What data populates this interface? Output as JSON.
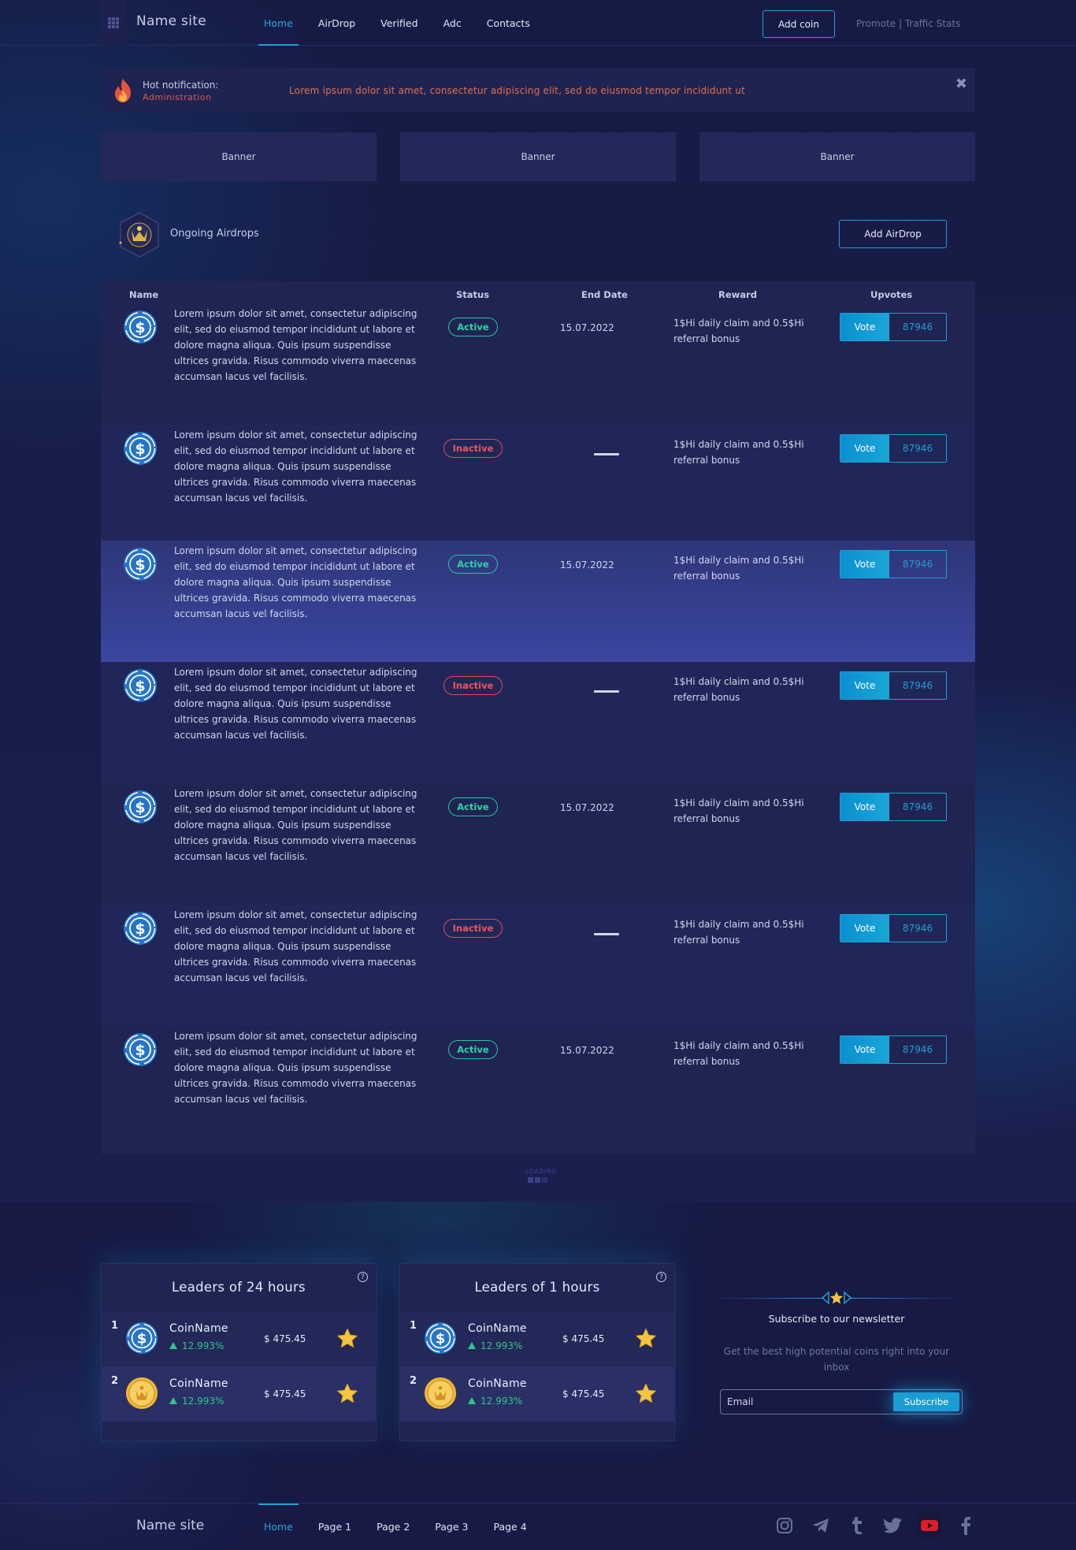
{
  "header": {
    "site_name": "Name site",
    "nav": [
      "Home",
      "AirDrop",
      "Verified",
      "Adc",
      "Contacts"
    ],
    "add_coin": "Add coin",
    "links": "Promote | Traffic Stats"
  },
  "notification": {
    "title": "Hot notification:",
    "subtitle": "Administration",
    "text": "Lorem ipsum dolor sit amet, consectetur adipiscing elit, sed do eiusmod tempor incididunt ut",
    "close": "✖"
  },
  "banners": [
    "Banner",
    "Banner",
    "Banner"
  ],
  "section": {
    "title": "Ongoing Airdrops",
    "add_button": "Add AirDrop"
  },
  "table": {
    "headers": [
      "Name",
      "Status",
      "End Date",
      "Reward",
      "Upvotes"
    ],
    "rows": [
      {
        "desc": "Lorem ipsum dolor sit amet, consectetur adipiscing elit, sed do eiusmod tempor incididunt ut labore et dolore magna aliqua. Quis ipsum suspendisse ultrices gravida. Risus commodo viverra maecenas accumsan lacus vel facilisis.",
        "status": "Active",
        "end_date": "15.07.2022",
        "reward": "1$Hi daily claim and 0.5$Hi referral bonus",
        "vote": "Vote",
        "count": "87946"
      },
      {
        "desc": "Lorem ipsum dolor sit amet, consectetur adipiscing elit, sed do eiusmod tempor incididunt ut labore et dolore magna aliqua. Quis ipsum suspendisse ultrices gravida. Risus commodo viverra maecenas accumsan lacus vel facilisis.",
        "status": "Inactive",
        "end_date": "",
        "reward": "1$Hi daily claim and 0.5$Hi referral bonus",
        "vote": "Vote",
        "count": "87946"
      },
      {
        "desc": "Lorem ipsum dolor sit amet, consectetur adipiscing elit, sed do eiusmod tempor incididunt ut labore et dolore magna aliqua. Quis ipsum suspendisse ultrices gravida. Risus commodo viverra maecenas accumsan lacus vel facilisis.",
        "status": "Active",
        "end_date": "15.07.2022",
        "reward": "1$Hi daily claim and 0.5$Hi referral bonus",
        "vote": "Vote",
        "count": "87946"
      },
      {
        "desc": "Lorem ipsum dolor sit amet, consectetur adipiscing elit, sed do eiusmod tempor incididunt ut labore et dolore magna aliqua. Quis ipsum suspendisse ultrices gravida. Risus commodo viverra maecenas accumsan lacus vel facilisis.",
        "status": "Inactive",
        "end_date": "",
        "reward": "1$Hi daily claim and 0.5$Hi referral bonus",
        "vote": "Vote",
        "count": "87946"
      },
      {
        "desc": "Lorem ipsum dolor sit amet, consectetur adipiscing elit, sed do eiusmod tempor incididunt ut labore et dolore magna aliqua. Quis ipsum suspendisse ultrices gravida. Risus commodo viverra maecenas accumsan lacus vel facilisis.",
        "status": "Active",
        "end_date": "15.07.2022",
        "reward": "1$Hi daily claim and 0.5$Hi referral bonus",
        "vote": "Vote",
        "count": "87946"
      },
      {
        "desc": "Lorem ipsum dolor sit amet, consectetur adipiscing elit, sed do eiusmod tempor incididunt ut labore et dolore magna aliqua. Quis ipsum suspendisse ultrices gravida. Risus commodo viverra maecenas accumsan lacus vel facilisis.",
        "status": "Inactive",
        "end_date": "",
        "reward": "1$Hi daily claim and 0.5$Hi referral bonus",
        "vote": "Vote",
        "count": "87946"
      },
      {
        "desc": "Lorem ipsum dolor sit amet, consectetur adipiscing elit, sed do eiusmod tempor incididunt ut labore et dolore magna aliqua. Quis ipsum suspendisse ultrices gravida. Risus commodo viverra maecenas accumsan lacus vel facilisis.",
        "status": "Active",
        "end_date": "15.07.2022",
        "reward": "1$Hi daily claim and 0.5$Hi referral bonus",
        "vote": "Vote",
        "count": "87946"
      }
    ]
  },
  "loading": "LOADING",
  "leaders": [
    {
      "title": "Leaders of 24 hours",
      "rows": [
        {
          "rank": "1",
          "name": "CoinName",
          "change": "12.993%",
          "price": "$ 475.45",
          "coin": "usdc-icon"
        },
        {
          "rank": "2",
          "name": "CoinName",
          "change": "12.993%",
          "price": "$ 475.45",
          "coin": "gold-coin-icon"
        }
      ]
    },
    {
      "title": "Leaders of 1 hours",
      "rows": [
        {
          "rank": "1",
          "name": "CoinName",
          "change": "12.993%",
          "price": "$ 475.45",
          "coin": "usdc-icon"
        },
        {
          "rank": "2",
          "name": "CoinName",
          "change": "12.993%",
          "price": "$ 475.45",
          "coin": "gold-coin-icon"
        }
      ]
    }
  ],
  "newsletter": {
    "title": "Subscribe to our newsletter",
    "subtitle": "Get the best high potential coins right into your inbox",
    "placeholder": "Email",
    "button": "Subscribe"
  },
  "footer": {
    "site_name": "Name site",
    "nav": [
      "Home",
      "Page 1",
      "Page 2",
      "Page 3",
      "Page 4"
    ],
    "socials": [
      "instagram-icon",
      "telegram-icon",
      "tumblr-icon",
      "twitter-icon",
      "youtube-icon",
      "facebook-icon"
    ]
  },
  "colors": {
    "accent": "#1e9fd2",
    "active": "#27d6a8",
    "inactive": "#f0525d",
    "background": "#15193f"
  }
}
